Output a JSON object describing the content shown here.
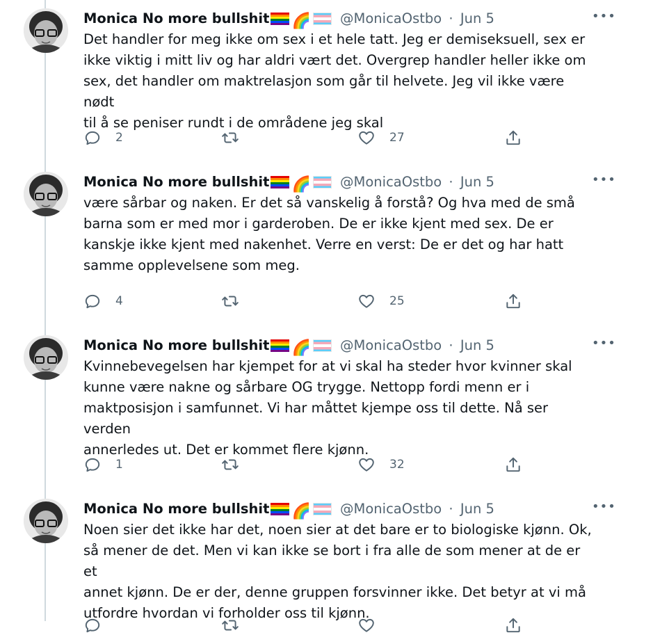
{
  "tweets": [
    {
      "author_name": "Monica No more bullshit",
      "handle": "@MonicaOstbo",
      "date": "Jun 5",
      "text": "Det handler for meg ikke om sex i et hele tatt. Jeg er demiseksuell, sex er\nikke viktig i mitt liv og har aldri vært det. Overgrep handler heller ikke om\nsex, det handler om maktrelasjon som går til helvete. Jeg vil ikke være nødt\ntil å se peniser rundt i de områdene jeg skal",
      "replies": "2",
      "retweets": "",
      "likes": "27"
    },
    {
      "author_name": "Monica No more bullshit",
      "handle": "@MonicaOstbo",
      "date": "Jun 5",
      "text": "være sårbar og naken. Er det så vanskelig å forstå? Og hva med de små\nbarna som er med mor i garderoben. De er ikke kjent med sex. De er\nkanskje ikke kjent med nakenhet. Verre en verst: De er det og har hatt\nsamme opplevelsene som meg.",
      "replies": "4",
      "retweets": "",
      "likes": "25"
    },
    {
      "author_name": "Monica No more bullshit",
      "handle": "@MonicaOstbo",
      "date": "Jun 5",
      "text": "Kvinnebevegelsen har kjempet for at vi skal ha steder hvor kvinner skal\nkunne være nakne og sårbare OG trygge. Nettopp fordi menn er i\nmaktposisjon i samfunnet. Vi har måttet kjempe oss til dette. Nå ser verden\nannerledes ut. Det er kommet flere kjønn.",
      "replies": "1",
      "retweets": "",
      "likes": "32"
    },
    {
      "author_name": "Monica No more bullshit",
      "handle": "@MonicaOstbo",
      "date": "Jun 5",
      "text": "Noen sier det ikke har det, noen sier at det bare er to biologiske kjønn. Ok,\nså mener de det. Men vi kan ikke se bort i fra alle de som mener at de er et\nannet kjønn. De er der, denne gruppen forsvinner ikke. Det betyr at vi må\nutfordre hvordan vi forholder oss til kjønn.",
      "replies": "",
      "retweets": "",
      "likes": ""
    }
  ],
  "ui": {
    "separator": "·",
    "rainbow_emoji": "🌈",
    "more_glyph": "•••"
  },
  "icons": {
    "more": "more-horizontal-icon",
    "reply": "reply-icon",
    "retweet": "retweet-icon",
    "like": "heart-icon",
    "share": "share-icon",
    "pride_flag": "rainbow-flag-icon",
    "trans_flag": "transgender-flag-icon"
  },
  "colors": {
    "text": "#0f1419",
    "secondary": "#536471",
    "thread_line": "#cfd9de"
  }
}
